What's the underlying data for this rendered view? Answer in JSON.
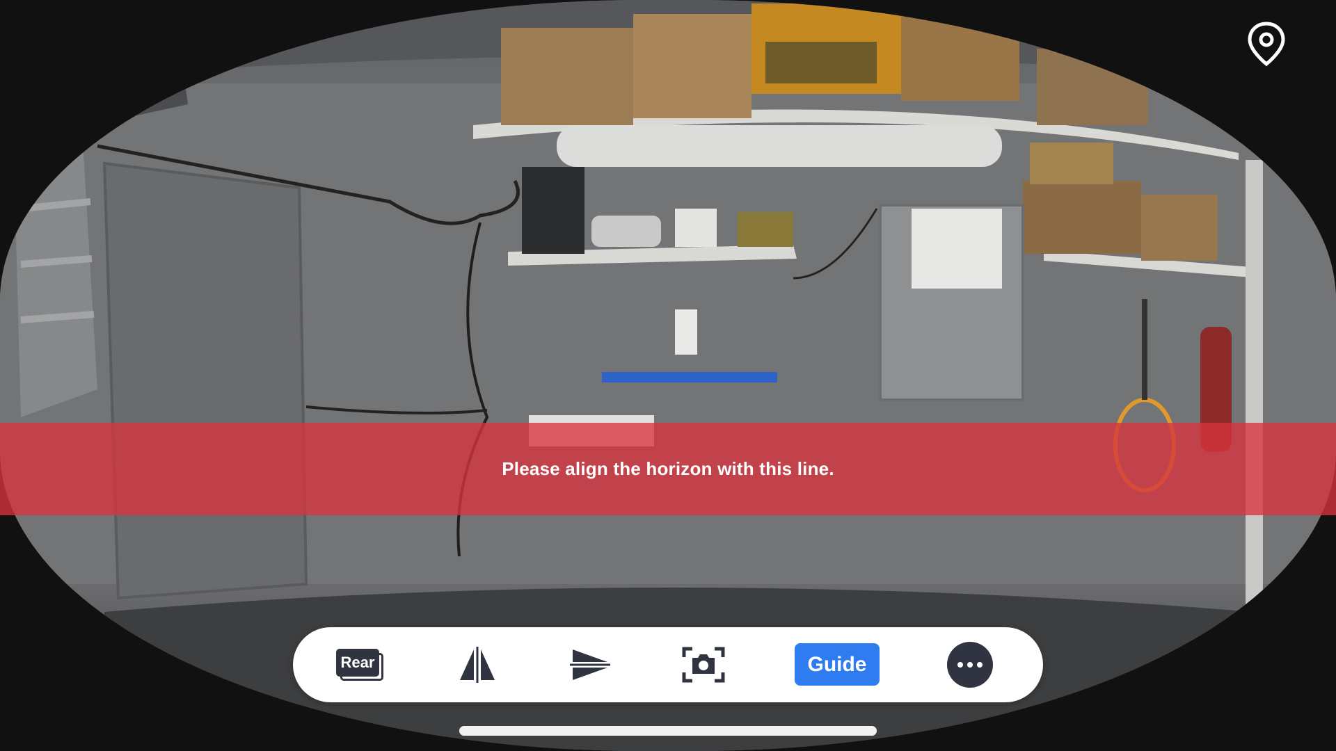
{
  "overlay": {
    "guide_message": "Please align the horizon with this line."
  },
  "toolbar": {
    "rear_label": "Rear",
    "mirror_icon": "mirror-icon",
    "flip_icon": "flip-vertical-icon",
    "snapshot_icon": "camera-icon",
    "guide_label": "Guide",
    "more_icon": "more-icon"
  },
  "top_right": {
    "location_icon": "location-pin-icon"
  },
  "colors": {
    "guide_band": "#d7343e",
    "guide_button": "#2f7bf0",
    "icon_dark": "#2f3440",
    "toolbar_bg": "#ffffff"
  }
}
